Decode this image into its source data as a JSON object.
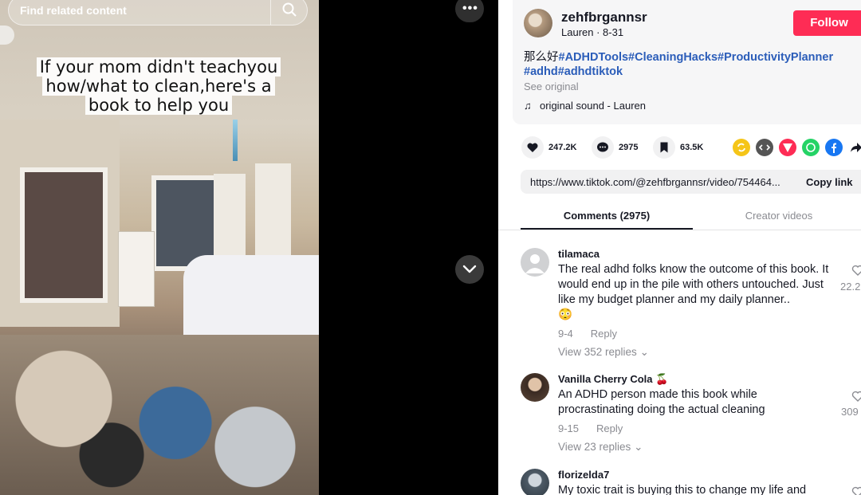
{
  "video": {
    "search_text": "Find related content",
    "caption": "If your mom didn't teachyou how/what to clean,here's a book to help you"
  },
  "player": {
    "more_label": "•••"
  },
  "post": {
    "username": "zehfbrgannsr",
    "author": "Lauren",
    "separator": " · ",
    "date": "8-31",
    "follow_label": "Follow",
    "desc_prefix": "那么好",
    "hashtags_line1": "#ADHDTools#CleaningHacks#ProductivityPlanner",
    "hashtags_line2": "#adhd#adhdtiktok",
    "see_original": "See original",
    "sound": "original sound - Lauren",
    "likes": "247.2K",
    "comments": "2975",
    "saves": "63.5K",
    "link": "https://www.tiktok.com/@zehfbrgannsr/video/754464...",
    "copy_label": "Copy link",
    "colors": {
      "follow": "#fe2c55",
      "hashtag": "#2b5db9"
    }
  },
  "share_icons": [
    "repost-icon",
    "embed-icon",
    "send-icon",
    "whatsapp-icon",
    "facebook-icon",
    "share-arrow-icon"
  ],
  "tabs": [
    {
      "label": "Comments (2975)",
      "active": true
    },
    {
      "label": "Creator videos",
      "active": false
    }
  ],
  "comments": [
    {
      "user": "tilamaca",
      "text": "The real adhd folks know the outcome of this book. It would end up in the pile with others untouched. Just like my budget planner and my daily planner..",
      "emoji": "😳",
      "date": "9-4",
      "reply": "Reply",
      "view_replies": "View 352 replies",
      "likes": "22.2"
    },
    {
      "user": "Vanilla Cherry Cola 🍒",
      "text": "An ADHD person made this book while procrastinating doing the actual cleaning",
      "date": "9-15",
      "reply": "Reply",
      "view_replies": "View 23 replies",
      "likes": "309"
    },
    {
      "user": "florizelda7",
      "text": "My toxic trait is buying this to change my life and"
    }
  ]
}
